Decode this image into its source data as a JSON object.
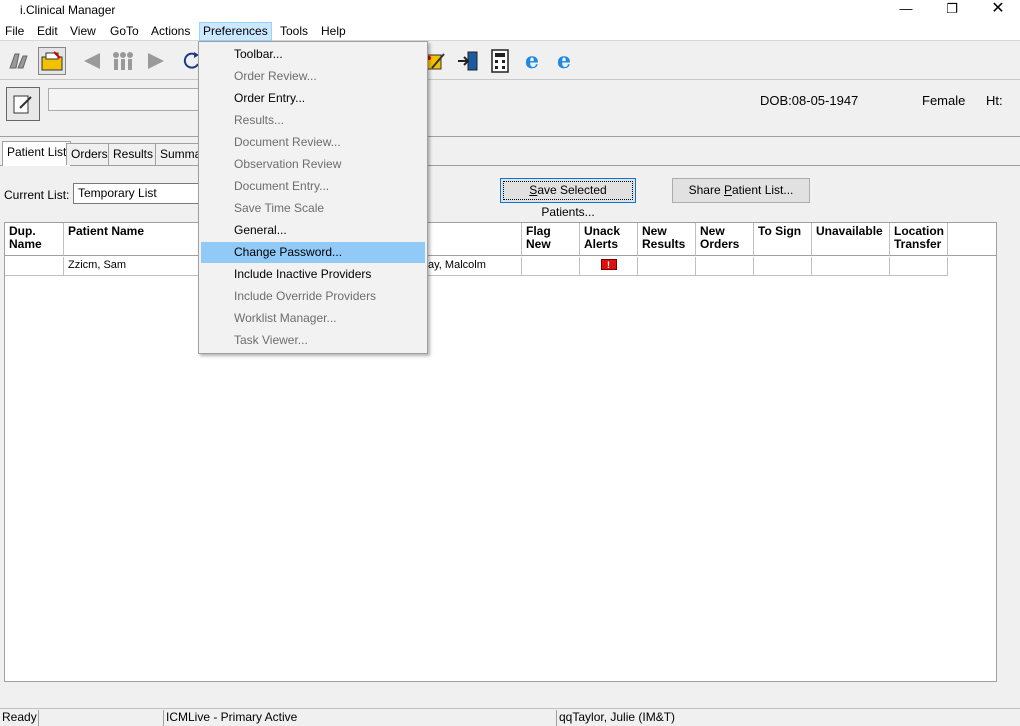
{
  "window": {
    "title": "i.Clinical Manager",
    "minimize": "—",
    "maximize": "❐",
    "close": "✕"
  },
  "menubar": {
    "items": [
      "File",
      "Edit",
      "View",
      "GoTo",
      "Actions",
      "Preferences",
      "Tools",
      "Help"
    ]
  },
  "toolbar": {
    "icons": [
      "patients-icon",
      "folder-icon",
      "back-icon",
      "people-icon",
      "forward-icon",
      "refresh-icon",
      "notes-icon",
      "exit-icon",
      "calculator-icon",
      "browser-icon",
      "browser-icon-2"
    ]
  },
  "patient": {
    "dob": "DOB:08-05-1947",
    "sex": "Female",
    "ht": "Ht:"
  },
  "tabs": [
    "Patient List",
    "Orders",
    "Results",
    "Summar"
  ],
  "current_list": {
    "label": "Current List:",
    "value": "Temporary List"
  },
  "buttons": {
    "save_selected_pre": "S",
    "save_selected_rest": "ave Selected Patients...",
    "share_pre": "Share ",
    "share_ul": "P",
    "share_rest": "atient List..."
  },
  "table": {
    "columns": {
      "dup_name": "Dup.\nName",
      "patient_name": "Patient Name",
      "flag_new": "Flag\nNew",
      "unack_alerts": "Unack\nAlerts",
      "new_results": "New\nResults",
      "new_orders": "New\nOrders",
      "to_sign": "To Sign",
      "unavailable": "Unavailable",
      "location_transfer": "Location\nTransfer"
    },
    "rows": [
      {
        "patient_name": "Zzicm, Sam",
        "provider": "ay, Malcolm",
        "alert": "!"
      }
    ]
  },
  "preferences_menu": {
    "items": [
      {
        "label": "Toolbar...",
        "enabled": true
      },
      {
        "label": "Order Review...",
        "enabled": false
      },
      {
        "label": "Order Entry...",
        "enabled": true
      },
      {
        "label": "Results...",
        "enabled": false
      },
      {
        "label": "Document Review...",
        "enabled": false
      },
      {
        "label": "Observation Review",
        "enabled": false
      },
      {
        "label": "Document Entry...",
        "enabled": false
      },
      {
        "label": "Save Time Scale",
        "enabled": false
      },
      {
        "label": "General...",
        "enabled": true
      },
      {
        "label": "Change Password...",
        "enabled": true,
        "highlighted": true
      },
      {
        "label": "Include Inactive Providers",
        "enabled": true
      },
      {
        "label": "Include Override Providers",
        "enabled": false
      },
      {
        "label": "Worklist Manager...",
        "enabled": false
      },
      {
        "label": "Task Viewer...",
        "enabled": false
      }
    ]
  },
  "statusbar": {
    "ready": "Ready",
    "system": "ICMLive - Primary Active",
    "user": "qqTaylor, Julie (IM&T)"
  }
}
